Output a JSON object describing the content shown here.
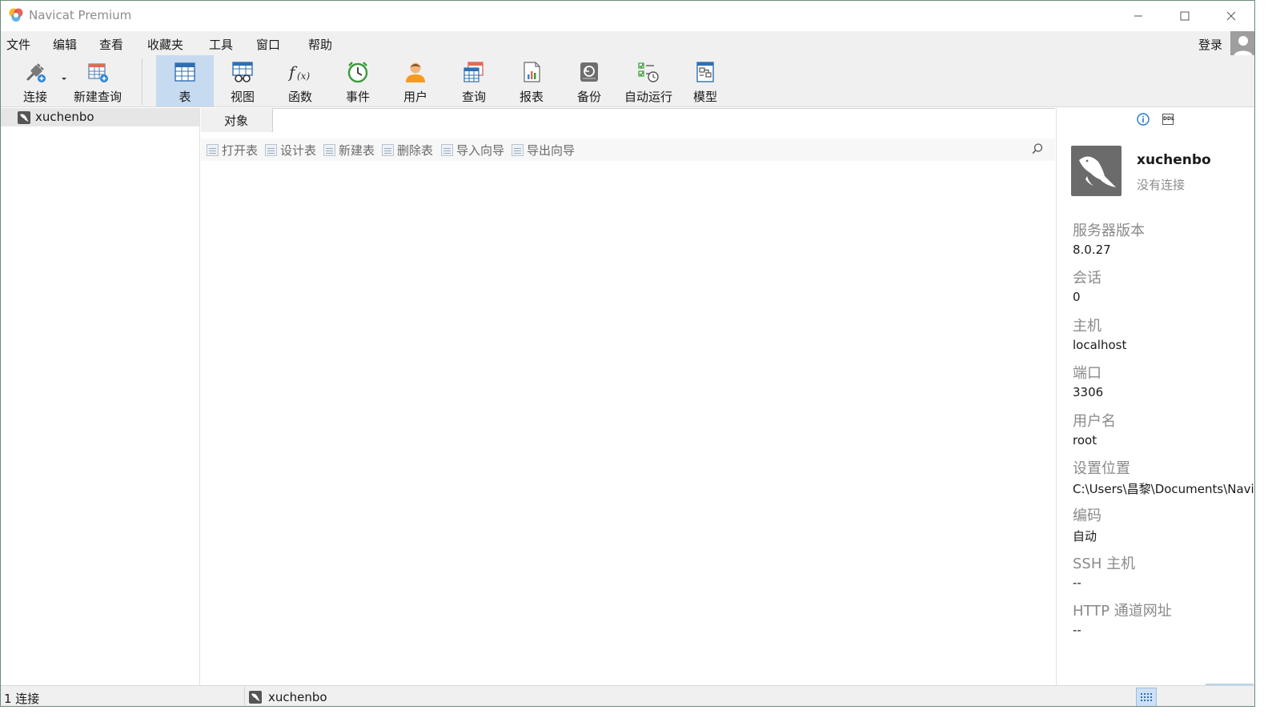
{
  "window": {
    "title": "Navicat Premium"
  },
  "menu": {
    "items": [
      "文件",
      "编辑",
      "查看",
      "收藏夹",
      "工具",
      "窗口",
      "帮助"
    ],
    "login": "登录"
  },
  "toolbar": {
    "connect": "连接",
    "new_query": "新建查询",
    "table": "表",
    "view": "视图",
    "function": "函数",
    "event": "事件",
    "user": "用户",
    "query": "查询",
    "report": "报表",
    "backup": "备份",
    "automation": "自动运行",
    "model": "模型",
    "active": "表"
  },
  "connections": {
    "items": [
      {
        "name": "xuchenbo"
      }
    ]
  },
  "objects": {
    "tab_label": "对象",
    "actions": {
      "open_table": "打开表",
      "design_table": "设计表",
      "new_table": "新建表",
      "delete_table": "删除表",
      "import_wizard": "导入向导",
      "export_wizard": "导出向导"
    }
  },
  "info": {
    "name": "xuchenbo",
    "status": "没有连接",
    "properties": [
      {
        "label": "服务器版本",
        "value": "8.0.27"
      },
      {
        "label": "会话",
        "value": "0"
      },
      {
        "label": "主机",
        "value": "localhost"
      },
      {
        "label": "端口",
        "value": "3306"
      },
      {
        "label": "用户名",
        "value": "root"
      },
      {
        "label": "设置位置",
        "value": "C:\\Users\\昌黎\\Documents\\Navi"
      },
      {
        "label": "编码",
        "value": "自动"
      },
      {
        "label": "SSH 主机",
        "value": "--"
      },
      {
        "label": "HTTP 通道网址",
        "value": "--"
      }
    ]
  },
  "statusbar": {
    "count": "1 连接",
    "current_connection": "xuchenbo"
  },
  "colors": {
    "active_tool_bg": "#c6daf0",
    "chrome_bg": "#f0f0f0",
    "accent_blue": "#1e78d2"
  }
}
